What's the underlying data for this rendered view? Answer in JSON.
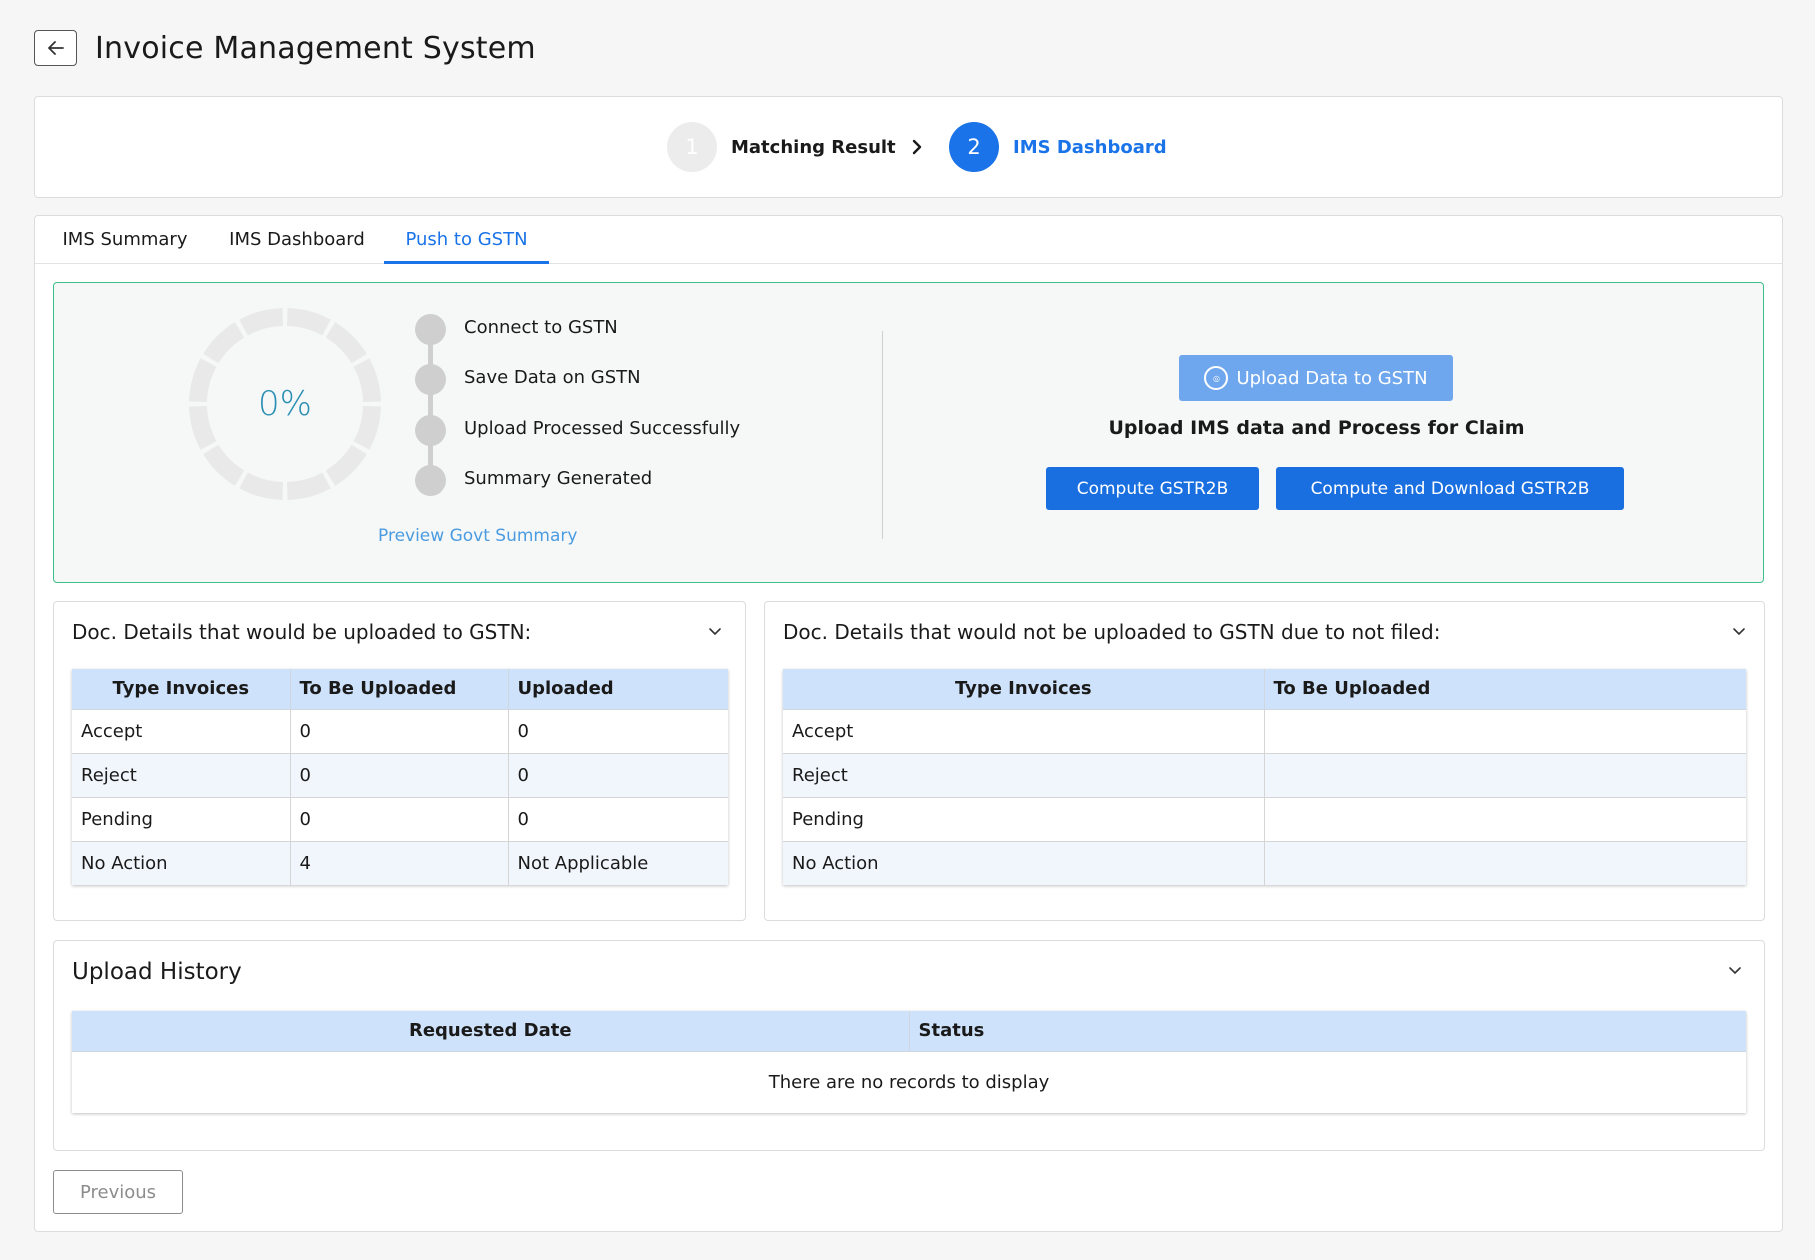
{
  "header": {
    "title": "Invoice Management System"
  },
  "stepper": {
    "steps": [
      {
        "number": "1",
        "label": "Matching Result"
      },
      {
        "number": "2",
        "label": "IMS Dashboard"
      }
    ]
  },
  "tabs": [
    {
      "label": "IMS Summary"
    },
    {
      "label": "IMS Dashboard"
    },
    {
      "label": "Push to GSTN"
    }
  ],
  "push_panel": {
    "progress_value": 0,
    "progress_text": "0%",
    "timeline": [
      "Connect to GSTN",
      "Save Data on GSTN",
      "Upload Processed Successfully",
      "Summary Generated"
    ],
    "preview_link": "Preview Govt Summary",
    "upload_button": "Upload Data to GSTN",
    "upload_subtitle": "Upload IMS data and Process for Claim",
    "compute_button": "Compute GSTR2B",
    "compute_download_button": "Compute and Download GSTR2B"
  },
  "uploaded_section": {
    "title": "Doc. Details that would be uploaded to GSTN:",
    "columns": [
      "Type Invoices",
      "To Be Uploaded",
      "Uploaded"
    ],
    "rows": [
      [
        "Accept",
        "0",
        "0"
      ],
      [
        "Reject",
        "0",
        "0"
      ],
      [
        "Pending",
        "0",
        "0"
      ],
      [
        "No Action",
        "4",
        "Not Applicable"
      ]
    ]
  },
  "not_uploaded_section": {
    "title": "Doc. Details that would not be uploaded to GSTN due to not filed:",
    "columns": [
      "Type Invoices",
      "To Be Uploaded"
    ],
    "rows": [
      [
        "Accept",
        ""
      ],
      [
        "Reject",
        ""
      ],
      [
        "Pending",
        ""
      ],
      [
        "No Action",
        ""
      ]
    ]
  },
  "history_section": {
    "title": "Upload History",
    "columns": [
      "Requested Date",
      "Status"
    ],
    "empty_text": "There are no records to display"
  },
  "footer": {
    "previous_button": "Previous"
  },
  "colors": {
    "primary": "#1a73e8",
    "success_border": "#3cc08a",
    "table_header": "#cfe2fb"
  }
}
